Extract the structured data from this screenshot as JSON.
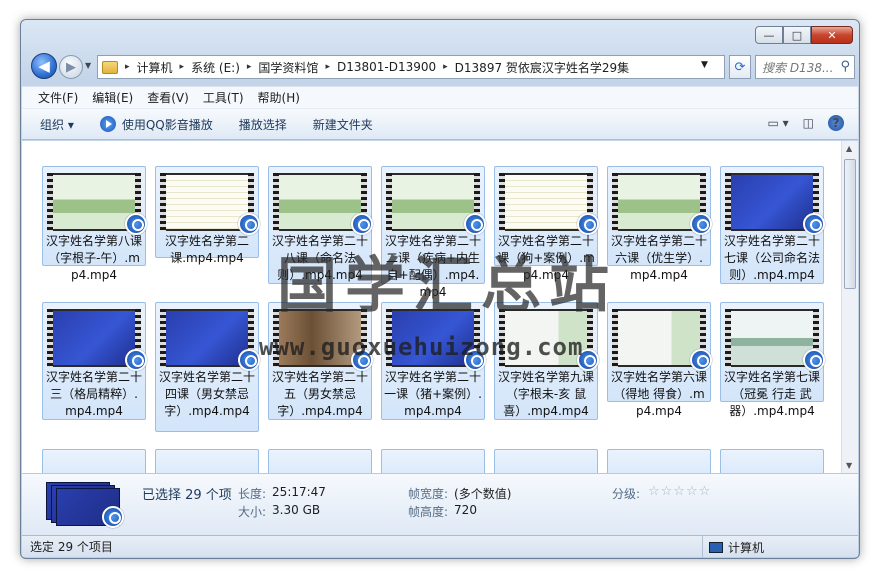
{
  "window": {
    "minimize": "—",
    "maximize": "□",
    "close": "✕"
  },
  "address": {
    "crumbs": [
      "计算机",
      "系统 (E:)",
      "国学资料馆",
      "D13801-D13900",
      "D13897 贺依宸汉字姓名学29集"
    ],
    "search_placeholder": "搜索 D138..."
  },
  "menu": [
    "文件(F)",
    "编辑(E)",
    "查看(V)",
    "工具(T)",
    "帮助(H)"
  ],
  "toolbar": {
    "organize": "组织 ▾",
    "play_qq": "使用QQ影音播放",
    "play_selected": "播放选择",
    "new_folder": "新建文件夹"
  },
  "files": [
    {
      "name": "汉字姓名学第八课（字根子-午）.mp4.mp4",
      "scene": "land"
    },
    {
      "name": "汉字姓名学第二课.mp4.mp4",
      "scene": "doc"
    },
    {
      "name": "汉字姓名学第二十八课（命名法则）.mp4.mp4",
      "scene": "land"
    },
    {
      "name": "汉字姓名学第二十二课（疾病+内生自+配偶）.mp4.mp4",
      "scene": "land"
    },
    {
      "name": "汉字姓名学第二十课（狗+案例）.mp4.mp4",
      "scene": "doc"
    },
    {
      "name": "汉字姓名学第二十六课（优生学）.mp4.mp4",
      "scene": "land"
    },
    {
      "name": "汉字姓名学第二十七课（公司命名法则）.mp4.mp4",
      "scene": "blue"
    },
    {
      "name": "汉字姓名学第二十三（格局精粹）.mp4.mp4",
      "scene": "blue"
    },
    {
      "name": "汉字姓名学第二十四课（男女禁忌字）.mp4.mp4",
      "scene": "blue"
    },
    {
      "name": "汉字姓名学第二十五（男女禁忌字）.mp4.mp4",
      "scene": "person"
    },
    {
      "name": "汉字姓名学第二十一课（猪+案例）.mp4.mp4",
      "scene": "blue"
    },
    {
      "name": "汉字姓名学第九课（字根未-亥 鼠喜）.mp4.mp4",
      "scene": "slide"
    },
    {
      "name": "汉字姓名学第六课（得地 得食）.mp4.mp4",
      "scene": "slide"
    },
    {
      "name": "汉字姓名学第七课（冠冕 行走 武器）.mp4.mp4",
      "scene": "lake"
    }
  ],
  "watermark": {
    "text": "国学汇总站",
    "url": "www.guoxuehuizong.com"
  },
  "details": {
    "selected": "已选择 29 个项",
    "length_label": "长度:",
    "length": "25:17:47",
    "size_label": "大小:",
    "size": "3.30 GB",
    "width_label": "帧宽度:",
    "width": "(多个数值)",
    "height_label": "帧高度:",
    "height": "720",
    "rating_label": "分级:",
    "rating": "☆☆☆☆☆"
  },
  "status": {
    "left": "选定 29 个项目",
    "right": "计算机"
  }
}
